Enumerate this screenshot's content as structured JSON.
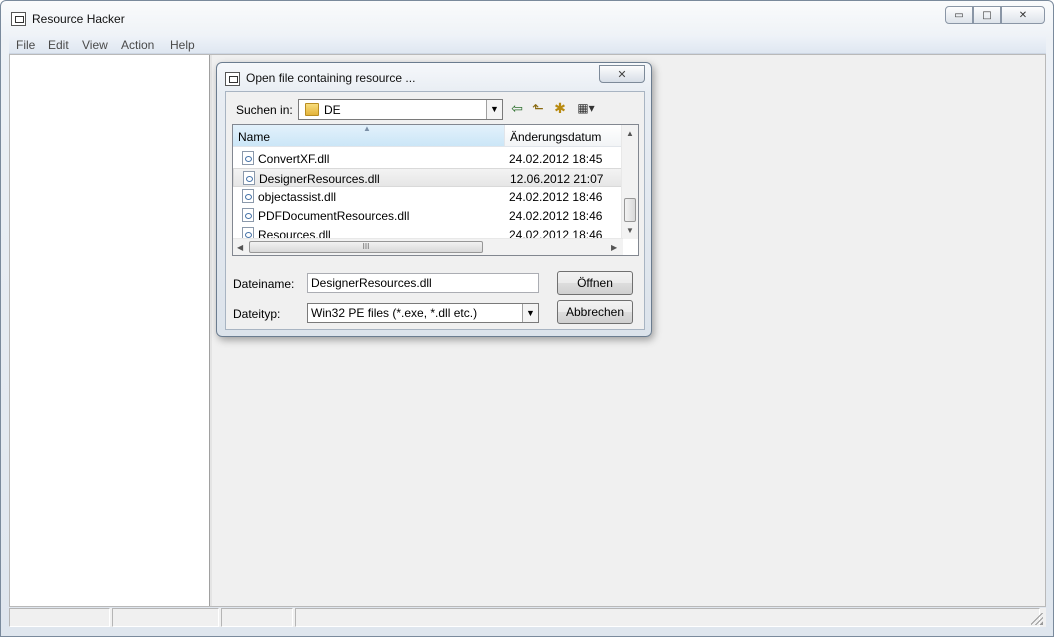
{
  "app": {
    "title": "Resource Hacker"
  },
  "window_controls": {
    "minimize": "▭",
    "maximize": "□",
    "close": "✕"
  },
  "menu": [
    "File",
    "Edit",
    "View",
    "Action",
    "Help"
  ],
  "dialog": {
    "title": "Open file containing resource ...",
    "close_glyph": "✕",
    "look_in_label": "Suchen in:",
    "look_in_value": "DE",
    "columns": {
      "name": "Name",
      "date": "Änderungsdatum"
    },
    "files": [
      {
        "name": "ConvertXF.dll",
        "date": "24.02.2012 18:45",
        "selected": false
      },
      {
        "name": "DesignerResources.dll",
        "date": "12.06.2012 21:07",
        "selected": true
      },
      {
        "name": "objectassist.dll",
        "date": "24.02.2012 18:46",
        "selected": false
      },
      {
        "name": "PDFDocumentResources.dll",
        "date": "24.02.2012 18:46",
        "selected": false
      },
      {
        "name": "Resources.dll",
        "date": "24.02.2012 18:46",
        "selected": false
      }
    ],
    "filename_label": "Dateiname:",
    "filename_value": "DesignerResources.dll",
    "filetype_label": "Dateityp:",
    "filetype_value": "Win32 PE files (*.exe, *.dll etc.)",
    "open_button": "Öffnen",
    "cancel_button": "Abbrechen",
    "scroll_grip": "III"
  },
  "icons": {
    "back": "⇦",
    "up_folder": "⬑",
    "new_folder": "✱",
    "view_menu": "▦▾",
    "dropdown": "▼",
    "up": "▲",
    "down": "▼",
    "left": "◀",
    "right": "▶"
  }
}
